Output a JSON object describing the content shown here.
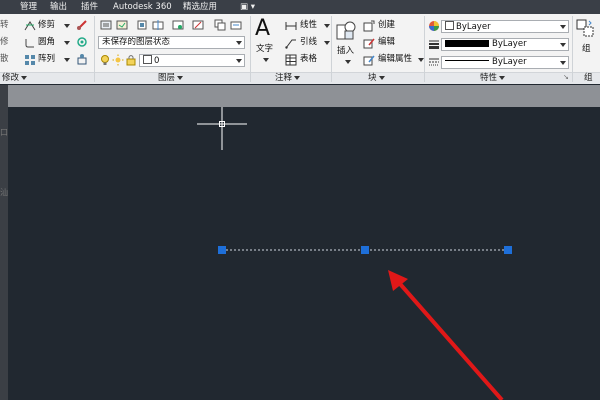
{
  "menu": {
    "items": [
      "管理",
      "输出",
      "插件",
      "Autodesk 360",
      "精选应用",
      "▣ ▾"
    ]
  },
  "ribbon": {
    "modify": {
      "left_glyphs": [
        "转",
        "修",
        "散"
      ],
      "rows": [
        "修剪",
        "圆角",
        "阵列"
      ],
      "title": "修改"
    },
    "layers": {
      "state_combo": "未保存的图层状态",
      "layer_combo": "0",
      "title": "图层"
    },
    "annotation": {
      "text_button": "文字",
      "rows": [
        "线性",
        "引线",
        "表格"
      ],
      "title": "注释"
    },
    "block": {
      "insert_button": "插入",
      "rows": [
        "创建",
        "编辑",
        "编辑属性"
      ],
      "title": "块"
    },
    "properties": {
      "color_combo": "ByLayer",
      "lineweight_combo": "ByLayer",
      "linetype_combo": "ByLayer",
      "title": "特性"
    },
    "group": {
      "button": "组",
      "title": "组"
    }
  },
  "left_edge": {
    "glyphs": [
      "口",
      "汕"
    ]
  },
  "colors": {
    "canvas": "#212830",
    "grip": "#1e6fd9",
    "arrow": "#e01818",
    "crosshair": "#ffffff"
  }
}
